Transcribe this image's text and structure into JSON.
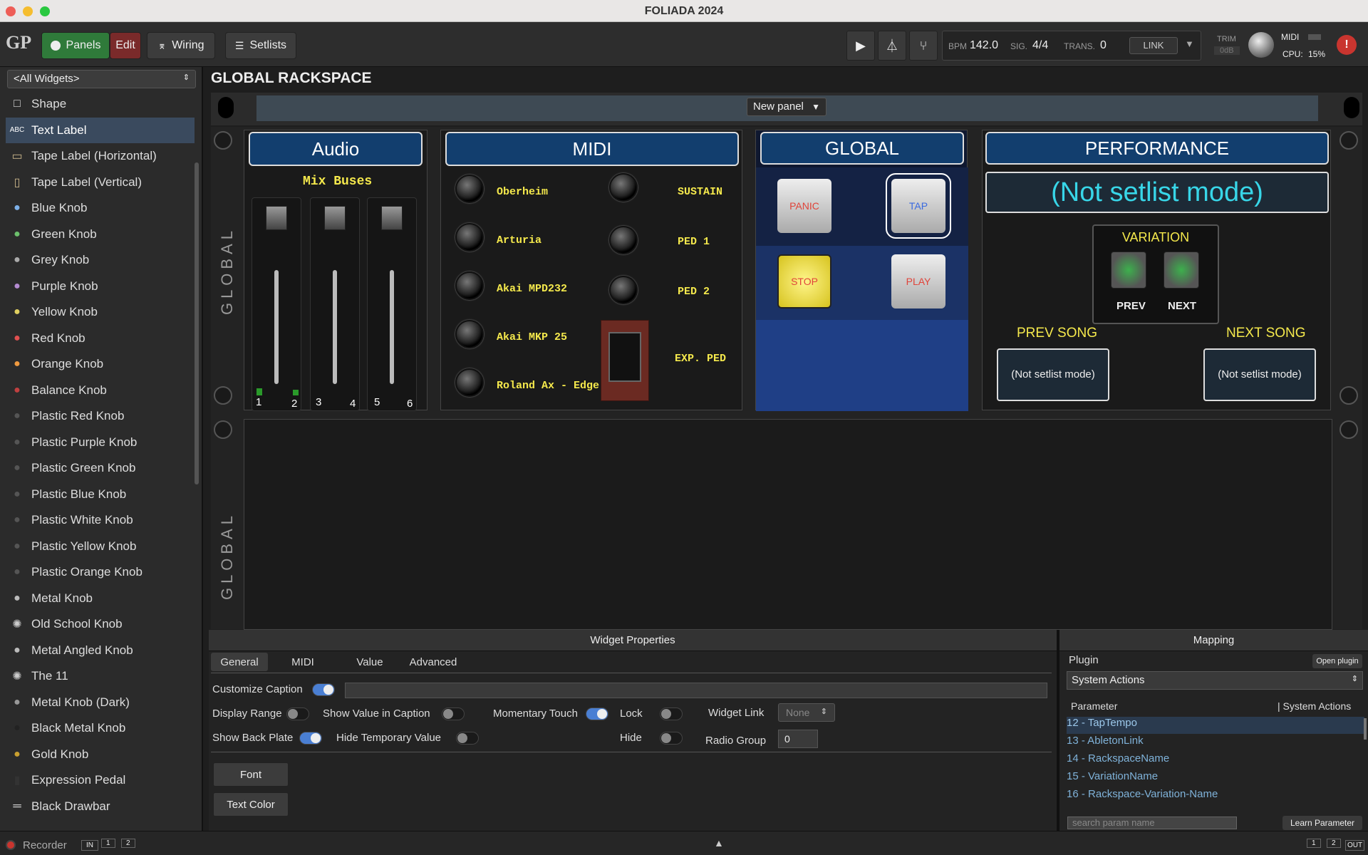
{
  "window": {
    "title": "FOLIADA 2024"
  },
  "toolbar": {
    "panels": "Panels",
    "edit": "Edit",
    "wiring": "Wiring",
    "setlists": "Setlists",
    "bpm_label": "BPM",
    "bpm": "142.0",
    "sig_label": "SIG.",
    "sig": "4/4",
    "trans_label": "TRANS.",
    "trans": "0",
    "link": "LINK",
    "trim_label": "TRIM",
    "trim": "0dB",
    "midi_label": "MIDI",
    "cpu_label": "CPU:",
    "cpu": "15%",
    "alert": "!"
  },
  "sidebar": {
    "filter": "<All Widgets>",
    "items": [
      "Shape",
      "Text Label",
      "Tape Label (Horizontal)",
      "Tape Label (Vertical)",
      "Blue Knob",
      "Green Knob",
      "Grey Knob",
      "Purple Knob",
      "Yellow Knob",
      "Red Knob",
      "Orange Knob",
      "Balance Knob",
      "Plastic Red Knob",
      "Plastic Purple Knob",
      "Plastic Green Knob",
      "Plastic Blue Knob",
      "Plastic White Knob",
      "Plastic Yellow Knob",
      "Plastic Orange Knob",
      "Metal Knob",
      "Old School Knob",
      "Metal Angled Knob",
      "The 11",
      "Metal Knob (Dark)",
      "Black Metal Knob",
      "Gold Knob",
      "Expression Pedal",
      "Black Drawbar"
    ]
  },
  "rack": {
    "heading": "GLOBAL RACKSPACE",
    "new_panel": "New panel",
    "side_label_top": "GLOBAL",
    "side_label_bottom": "GLOBAL"
  },
  "audio": {
    "title": "Audio",
    "subtitle": "Mix Buses",
    "channels": [
      "1",
      "2",
      "3",
      "4",
      "5",
      "6"
    ]
  },
  "midi": {
    "title": "MIDI",
    "devices": [
      "Oberheim",
      "Arturia",
      "Akai MPD232",
      "Akai MKP 25",
      "Roland Ax - Edge"
    ],
    "pedals": [
      "SUSTAIN",
      "PED 1",
      "PED 2",
      "EXP. PED"
    ]
  },
  "global": {
    "title": "GLOBAL",
    "panic": "PANIC",
    "tap": "TAP",
    "stop": "STOP",
    "play": "PLAY"
  },
  "performance": {
    "title": "PERFORMANCE",
    "status": "(Not setlist mode)",
    "variation": "VARIATION",
    "prev": "PREV",
    "next": "NEXT",
    "prev_song": "PREV SONG",
    "next_song": "NEXT SONG",
    "prev_song_value": "(Not setlist mode)",
    "next_song_value": "(Not setlist mode)"
  },
  "properties": {
    "header": "Widget Properties",
    "tabs": [
      "General",
      "MIDI",
      "Value",
      "Advanced"
    ],
    "customize_caption": "Customize Caption",
    "display_range": "Display Range",
    "show_value": "Show Value in Caption",
    "momentary": "Momentary Touch",
    "lock": "Lock",
    "widget_link": "Widget Link",
    "widget_link_value": "None",
    "show_back_plate": "Show Back Plate",
    "hide_temp": "Hide Temporary Value",
    "hide": "Hide",
    "radio_group": "Radio Group",
    "radio_group_value": "0",
    "font": "Font",
    "text_color": "Text Color"
  },
  "mapping": {
    "header": "Mapping",
    "plugin_label": "Plugin",
    "open_plugin": "Open plugin",
    "plugin_value": "System Actions",
    "param_label": "Parameter",
    "param_col": "| System Actions",
    "params": [
      "12 - TapTempo",
      "13 - AbletonLink",
      "14 - RackspaceName",
      "15 - VariationName",
      "16 - Rackspace-Variation-Name"
    ],
    "search_placeholder": "search param name",
    "learn": "Learn Parameter"
  },
  "status": {
    "recorder": "Recorder",
    "in": "IN",
    "ch1": "1",
    "ch2": "2",
    "out1": "1",
    "out2": "2",
    "out": "OUT"
  }
}
